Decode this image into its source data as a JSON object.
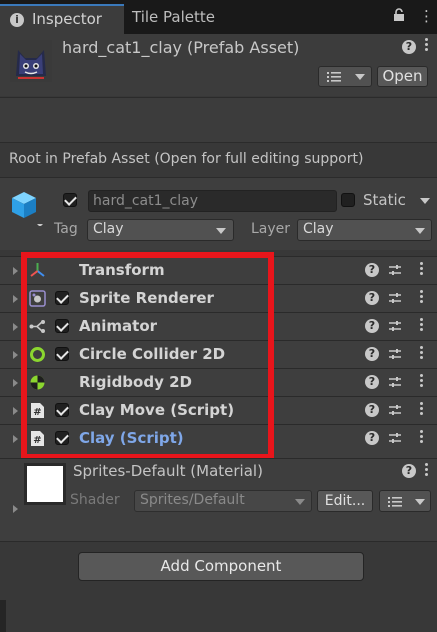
{
  "tabs": [
    {
      "label": "Inspector",
      "icon": "info-icon",
      "active": true
    },
    {
      "label": "Tile Palette",
      "active": false
    }
  ],
  "header": {
    "asset_title": "hard_cat1_clay (Prefab Asset)",
    "open_label": "Open"
  },
  "root_notice": "Root in Prefab Asset (Open for full editing support)",
  "game_object": {
    "active": true,
    "name": "hard_cat1_clay",
    "static_label": "Static",
    "static": false,
    "tag_label": "Tag",
    "tag_value": "Clay",
    "layer_label": "Layer",
    "layer_value": "Clay"
  },
  "components": [
    {
      "name": "Transform",
      "icon": "transform-icon",
      "has_checkbox": false,
      "enabled": null
    },
    {
      "name": "Sprite Renderer",
      "icon": "sprite-renderer-icon",
      "has_checkbox": true,
      "enabled": true
    },
    {
      "name": "Animator",
      "icon": "animator-icon",
      "has_checkbox": true,
      "enabled": true
    },
    {
      "name": "Circle Collider 2D",
      "icon": "circle-collider-icon",
      "has_checkbox": true,
      "enabled": true
    },
    {
      "name": "Rigidbody 2D",
      "icon": "rigidbody-icon",
      "has_checkbox": false,
      "enabled": null
    },
    {
      "name": "Clay Move (Script)",
      "icon": "script-icon",
      "has_checkbox": true,
      "enabled": true
    },
    {
      "name": "Clay (Script)",
      "icon": "script-icon",
      "has_checkbox": true,
      "enabled": true,
      "highlighted": true
    }
  ],
  "material": {
    "name": "Sprites-Default (Material)",
    "shader_label": "Shader",
    "shader_value": "Sprites/Default",
    "edit_label": "Edit..."
  },
  "add_component_label": "Add Component",
  "colors": {
    "highlight_box": "#e8151b",
    "script_link": "#7fa7e8",
    "active_tab_accent": "#3a79bb"
  }
}
